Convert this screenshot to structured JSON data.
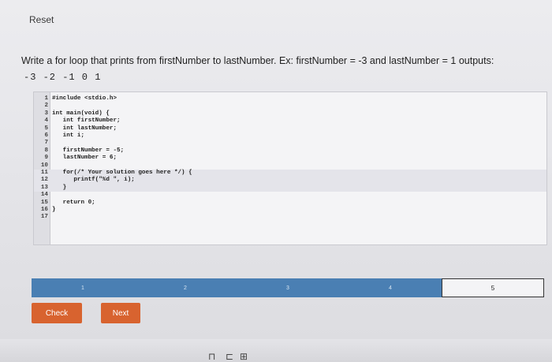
{
  "header": {
    "reset_label": "Reset"
  },
  "instructions": {
    "prompt": "Write a for loop that prints from firstNumber to lastNumber. Ex: firstNumber = -3 and lastNumber = 1 outputs:",
    "expected_output": "-3 -2 -1 0 1"
  },
  "editor": {
    "lines": [
      {
        "num": "1",
        "code": "#include <stdio.h>"
      },
      {
        "num": "2",
        "code": ""
      },
      {
        "num": "3",
        "code": "int main(void) {"
      },
      {
        "num": "4",
        "code": "   int firstNumber;"
      },
      {
        "num": "5",
        "code": "   int lastNumber;"
      },
      {
        "num": "6",
        "code": "   int i;"
      },
      {
        "num": "7",
        "code": ""
      },
      {
        "num": "8",
        "code": "   firstNumber = -5;"
      },
      {
        "num": "9",
        "code": "   lastNumber = 6;"
      },
      {
        "num": "10",
        "code": ""
      },
      {
        "num": "11",
        "code": "   for(/* Your solution goes here */) {"
      },
      {
        "num": "12",
        "code": "      printf(\"%d \", i);"
      },
      {
        "num": "13",
        "code": "   }"
      },
      {
        "num": "14",
        "code": ""
      },
      {
        "num": "15",
        "code": "   return 0;"
      },
      {
        "num": "16",
        "code": "}"
      },
      {
        "num": "17",
        "code": ""
      }
    ]
  },
  "progress": {
    "segments": [
      {
        "label": "1"
      },
      {
        "label": "2"
      },
      {
        "label": "3"
      },
      {
        "label": "4"
      },
      {
        "label": "5",
        "current": true
      }
    ]
  },
  "actions": {
    "check_label": "Check",
    "next_label": "Next"
  },
  "colors": {
    "progress_bar": "#4a7fb3",
    "button": "#d8632f"
  }
}
